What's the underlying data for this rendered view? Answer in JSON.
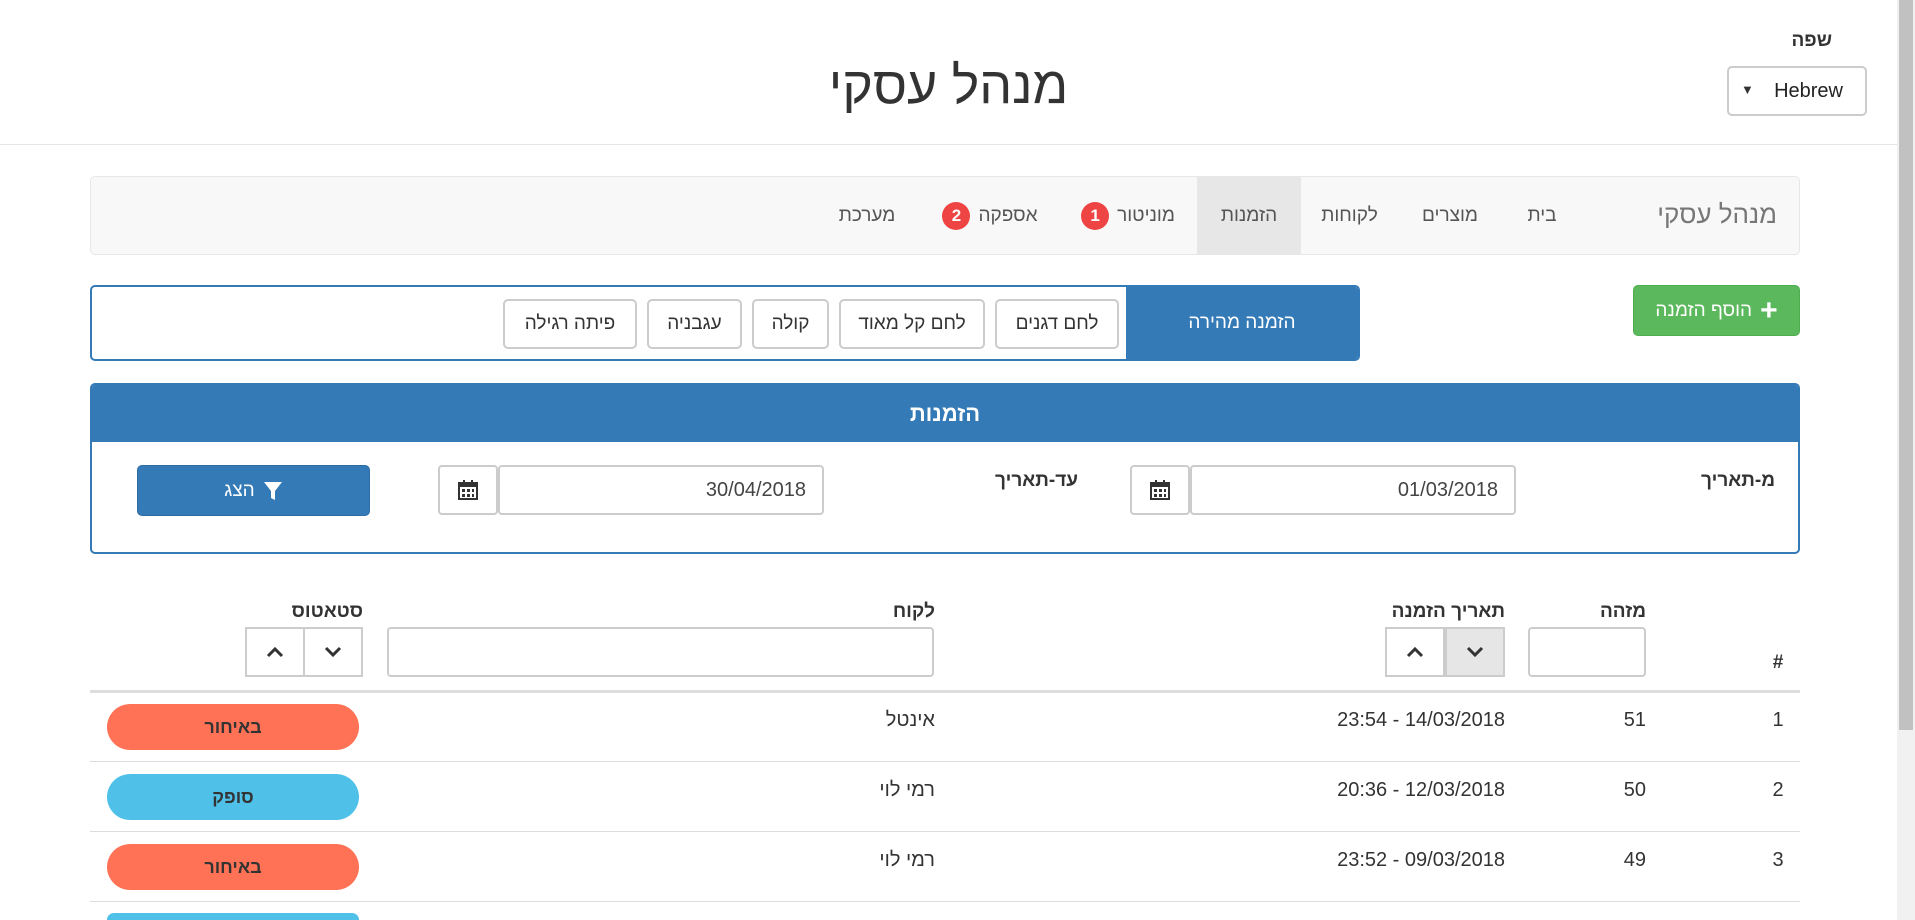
{
  "header": {
    "title": "מנהל עסקי",
    "language_label": "שפה",
    "language_value": "Hebrew",
    "language_arrow": "▼"
  },
  "nav": {
    "brand": "מנהל עסקי",
    "items": [
      {
        "label": "בית"
      },
      {
        "label": "מוצרים"
      },
      {
        "label": "לקוחות"
      },
      {
        "label": "הזמנות",
        "active": true
      },
      {
        "label": "מוניטור",
        "badge": "1"
      },
      {
        "label": "אספקה",
        "badge": "2"
      },
      {
        "label": "מערכת"
      }
    ]
  },
  "actions": {
    "add_order_label": "הוסף הזמנה",
    "plus_glyph": "+"
  },
  "quick_order": {
    "title": "הזמנה מהירה",
    "items": [
      "לחם דגנים",
      "לחם קל מאוד",
      "קולה",
      "עגבניה",
      "פיתה רגילה"
    ]
  },
  "orders_panel": {
    "title": "הזמנות",
    "from_label": "מ-תאריך",
    "from_value": "01/03/2018",
    "to_label": "עד-תאריך",
    "to_value": "30/04/2018",
    "show_label": "הצג"
  },
  "table": {
    "columns": {
      "index": "#",
      "id": "מזהה",
      "date": "תאריך הזמנה",
      "customer": "לקוח",
      "status": "סטאטוס"
    },
    "rows": [
      {
        "index": "1",
        "id": "51",
        "date": "23:54 - 14/03/2018",
        "customer": "אינטל",
        "status": "באיחור",
        "status_color": "#ff7256"
      },
      {
        "index": "2",
        "id": "50",
        "date": "20:36 - 12/03/2018",
        "customer": "רמי לוי",
        "status": "סופק",
        "status_color": "#4fc1e9"
      },
      {
        "index": "3",
        "id": "49",
        "date": "23:52 - 09/03/2018",
        "customer": "רמי לוי",
        "status": "באיחור",
        "status_color": "#ff7256"
      }
    ]
  },
  "colors": {
    "primary": "#337ab7",
    "success": "#5cb85c",
    "badge": "#ef4444",
    "late": "#ff7256",
    "delivered": "#4fc1e9"
  }
}
